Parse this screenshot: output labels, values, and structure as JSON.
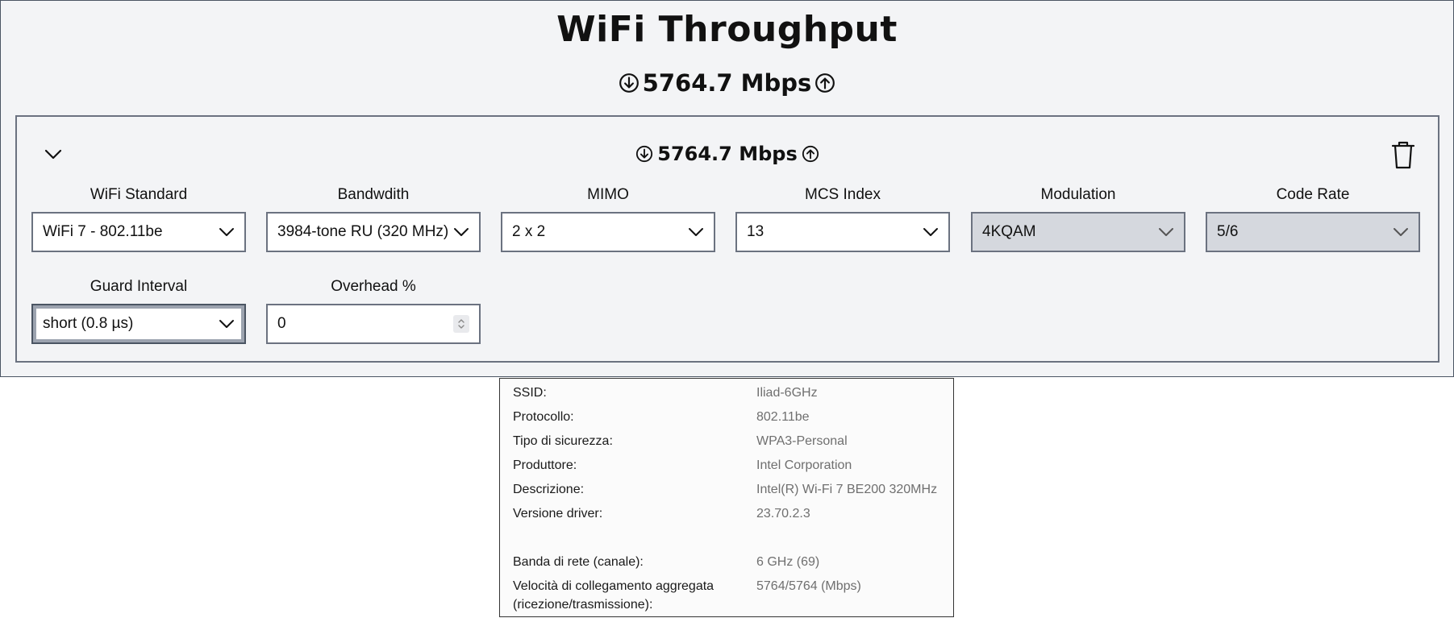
{
  "app": {
    "title": "WiFi Throughput",
    "total_speed": "5764.7 Mbps"
  },
  "card": {
    "speed": "5764.7 Mbps",
    "fields": {
      "wifi_standard": {
        "label": "WiFi Standard",
        "value": "WiFi 7 - 802.11be"
      },
      "bandwidth": {
        "label": "Bandwdith",
        "value": "3984-tone RU (320 MHz)"
      },
      "mimo": {
        "label": "MIMO",
        "value": "2 x 2"
      },
      "mcs_index": {
        "label": "MCS Index",
        "value": "13"
      },
      "modulation": {
        "label": "Modulation",
        "value": "4KQAM"
      },
      "code_rate": {
        "label": "Code Rate",
        "value": "5/6"
      },
      "guard_interval": {
        "label": "Guard Interval",
        "value": "short (0.8 µs)"
      },
      "overhead": {
        "label": "Overhead %",
        "value": "0"
      }
    }
  },
  "info": {
    "rows": [
      {
        "label": "SSID:",
        "value": "Iliad-6GHz"
      },
      {
        "label": "Protocollo:",
        "value": "802.11be"
      },
      {
        "label": "Tipo di sicurezza:",
        "value": "WPA3-Personal"
      },
      {
        "label": "Produttore:",
        "value": "Intel Corporation"
      },
      {
        "label": "Descrizione:",
        "value": "Intel(R) Wi-Fi 7 BE200 320MHz"
      },
      {
        "label": "Versione driver:",
        "value": "23.70.2.3"
      },
      {
        "label": "Banda di rete (canale):",
        "value": "6 GHz (69)"
      },
      {
        "label": "Velocità di collegamento aggregata (ricezione/trasmissione):",
        "value": "5764/5764 (Mbps)"
      }
    ]
  },
  "colors": {
    "app_background": "#f3f4f6",
    "border": "#6b7280",
    "disabled_field": "#d5d8de",
    "info_value": "#6f6f6f"
  },
  "icons": [
    "arrow-down-circle-icon",
    "arrow-up-circle-icon",
    "chevron-down-icon",
    "trash-icon"
  ]
}
